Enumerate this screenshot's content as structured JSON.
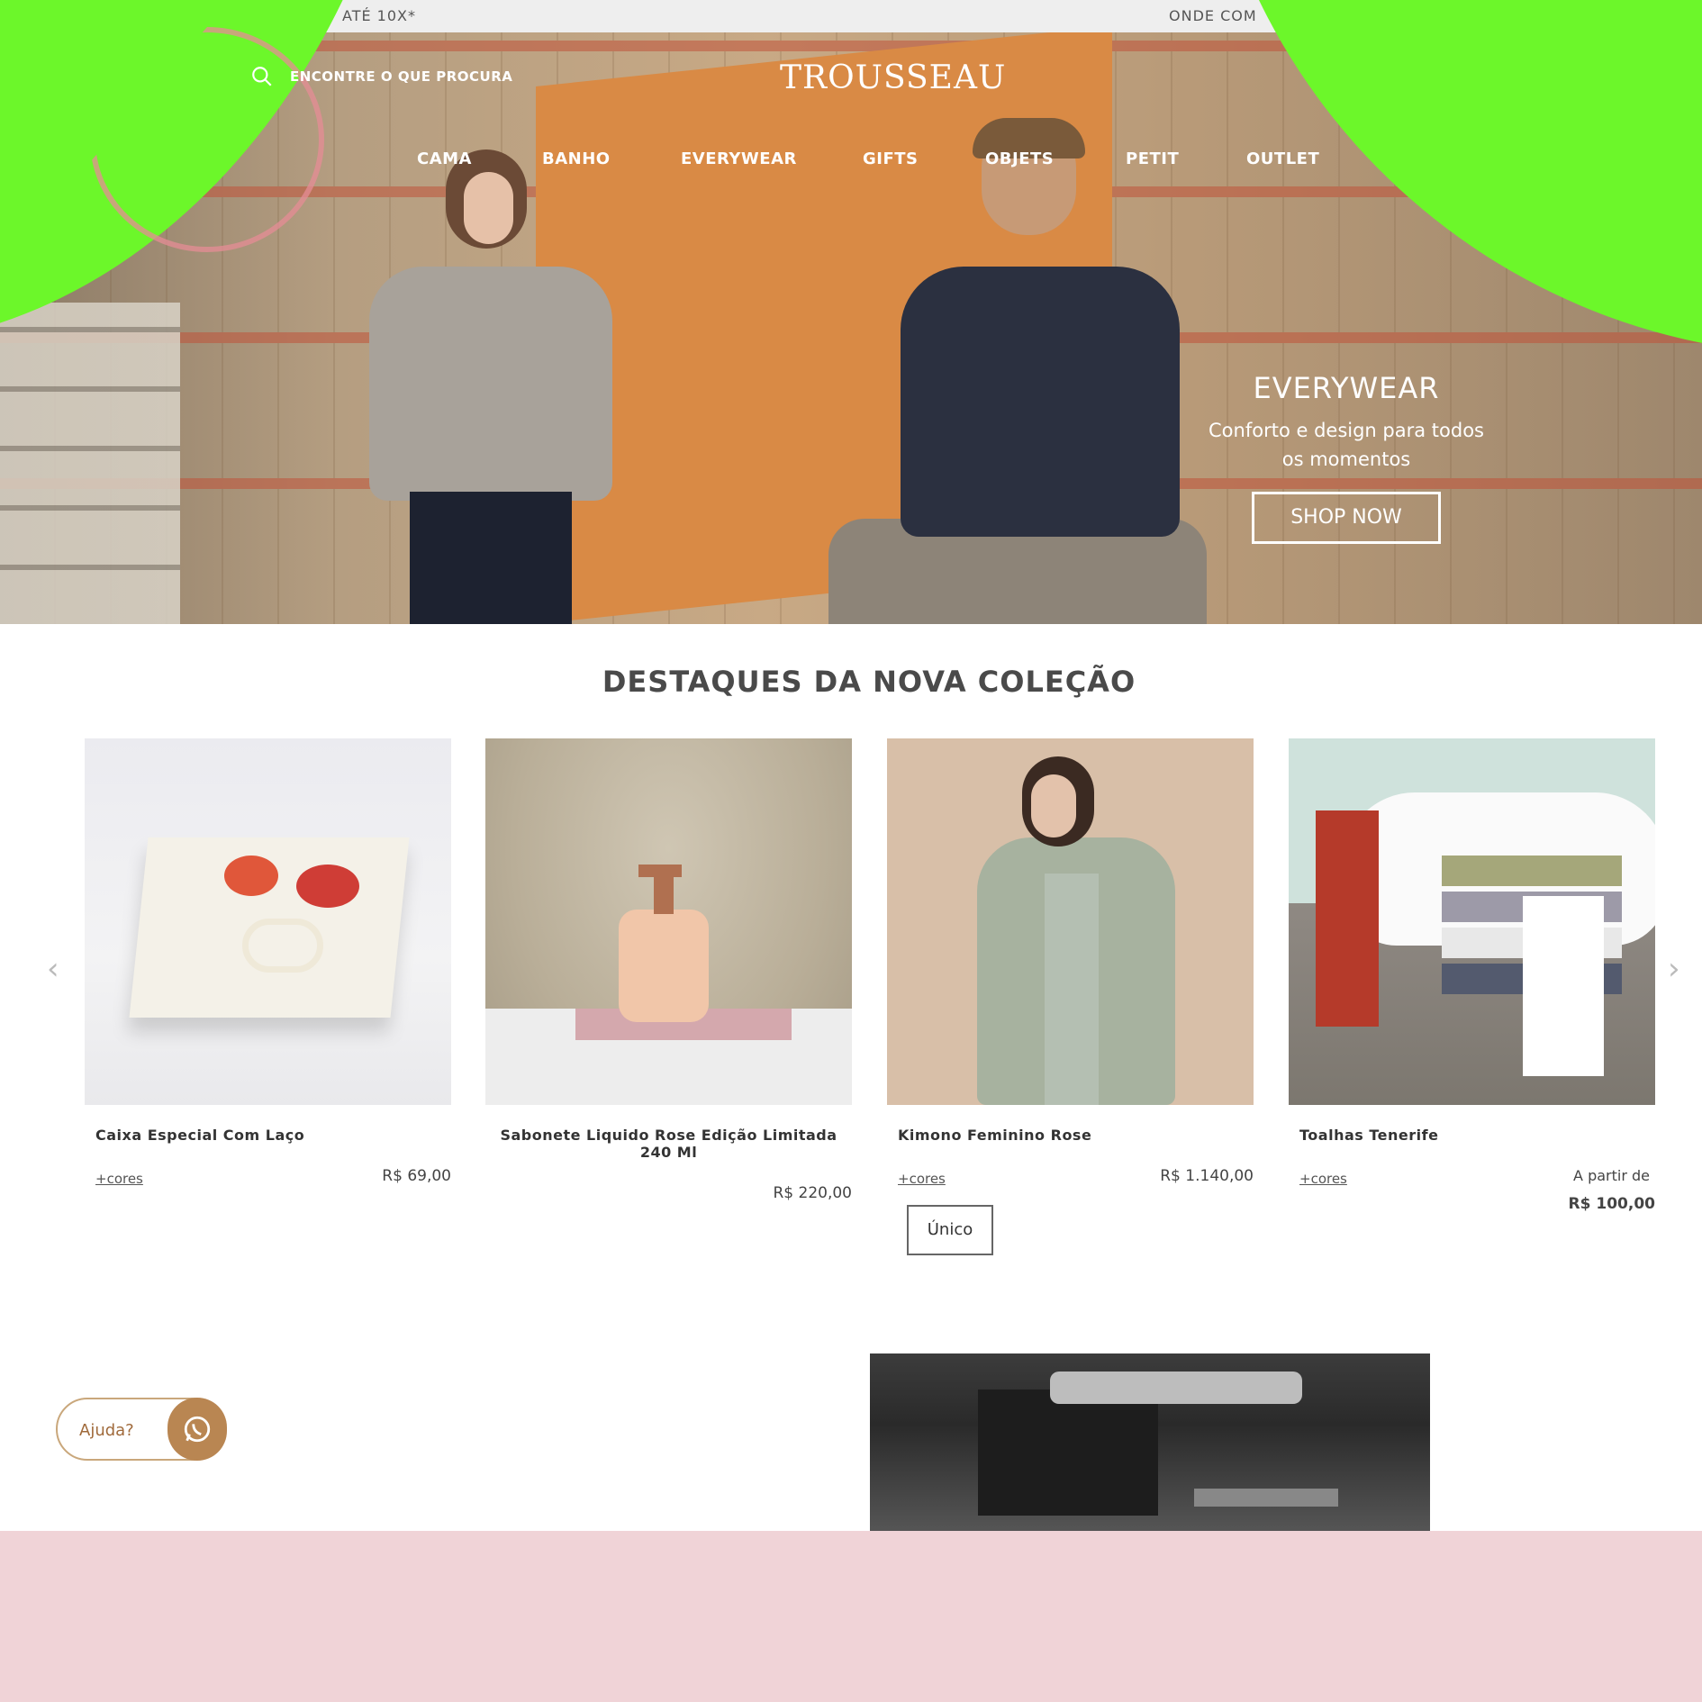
{
  "topbar": {
    "left_text": "ATÉ 10X*",
    "right_text": "ONDE COM"
  },
  "header": {
    "search_placeholder": "ENCONTRE O QUE PROCURA",
    "logo": "TROUSSEAU",
    "nav": [
      "CAMA",
      "BANHO",
      "EVERYWEAR",
      "GIFTS",
      "OBJETS",
      "PETIT",
      "OUTLET"
    ]
  },
  "hero": {
    "title": "EVERYWEAR",
    "subtitle": "Conforto e design para todos os momentos",
    "cta": "SHOP NOW"
  },
  "section": {
    "title": "DESTAQUES DA NOVA COLEÇÃO"
  },
  "carousel": {
    "prev_arrow": "‹",
    "next_arrow": "›",
    "products": [
      {
        "name": "Caixa Especial Com Laço",
        "cores": "+cores",
        "price": "R$ 69,00"
      },
      {
        "name": "Sabonete Liquido Rose Edição Limitada 240 Ml",
        "price": "R$ 220,00"
      },
      {
        "name": "Kimono Feminino Rose",
        "cores": "+cores",
        "price": "R$ 1.140,00",
        "badge": "Único"
      },
      {
        "name": "Toalhas Tenerife",
        "cores": "+cores",
        "price_prefix": "A partir de",
        "price": "R$ 100,00"
      }
    ]
  },
  "help_widget": {
    "label": "Ajuda?",
    "icon": "whatsapp-icon"
  },
  "colors": {
    "overlay_green": "#6cf72a",
    "pink_band": "#f0d3d7",
    "accent_brown": "#b98652"
  }
}
